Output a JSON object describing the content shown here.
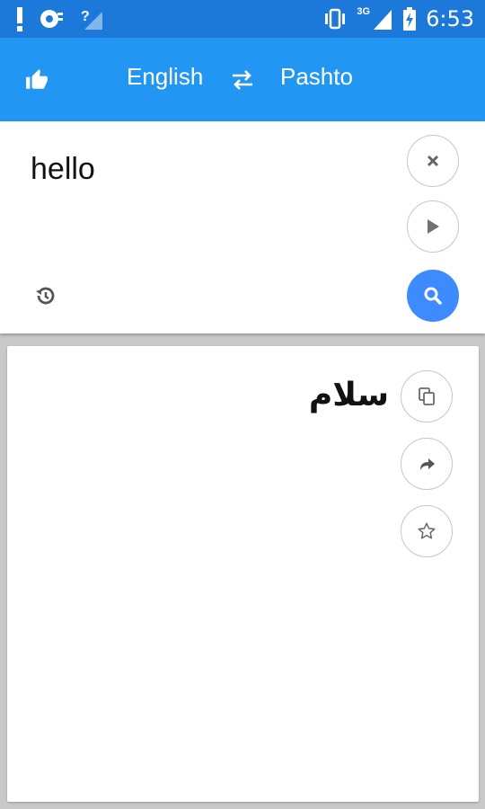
{
  "status_bar": {
    "time": "6:53",
    "network": "3G",
    "icons": [
      "alert-icon",
      "record-icon",
      "wifi-unknown-icon",
      "vibrate-icon",
      "signal-icon",
      "battery-charging-icon"
    ]
  },
  "app_bar": {
    "source_language": "English",
    "target_language": "Pashto",
    "icons": [
      "thumbs-up-icon",
      "swap-icon"
    ]
  },
  "input": {
    "text": "hello",
    "icons": [
      "close-icon",
      "play-icon",
      "search-icon",
      "history-icon"
    ]
  },
  "output": {
    "text": "سلام",
    "icons": [
      "copy-icon",
      "share-icon",
      "star-icon"
    ]
  },
  "colors": {
    "status_bar": "#1c78d9",
    "app_bar": "#2196f3",
    "search_button": "#3d8bff",
    "background": "#c9c9c9"
  }
}
